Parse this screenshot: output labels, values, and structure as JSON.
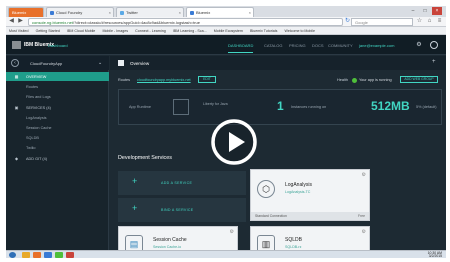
{
  "browser": {
    "tabs": [
      {
        "label": "Bluemix",
        "color": "#e8702a"
      },
      {
        "label": "Cloud Foundry",
        "color": "#3a7bd5"
      },
      {
        "label": "Twitter",
        "color": "#5aa9e6"
      },
      {
        "label": "Bluemix",
        "color": "#3a7bd5"
      }
    ],
    "url_host": "console.ng.bluemix.net",
    "url_path": "/?direct=classic/#/resources/appGuid=4ac8c9ad&bluemix.logstash=true",
    "search_placeholder": "Google",
    "bookmarks": [
      "Most Visited",
      "Getting Started",
      "IBM Cloud Mobile",
      "Mobile - Images",
      "Connect - Learning",
      "IBM Learning - Sca...",
      "Mobile Ecosystem",
      "Bluemix Tutorials",
      "Welcome to Mobile"
    ]
  },
  "app": {
    "brand": "IBM Bluemix",
    "brand_sub": "Dashboard",
    "nav": [
      "DASHBOARD",
      "CATALOG",
      "PRICING",
      "DOCS",
      "COMMUNITY"
    ],
    "active_nav": "DASHBOARD",
    "account": "jane@example.com"
  },
  "sidebar": {
    "app_name": "CloudFoundryApp",
    "items": [
      {
        "label": "OVERVIEW",
        "active": true
      },
      {
        "label": "Routes"
      },
      {
        "label": "Files and Logs"
      },
      {
        "label": "SERVICES (4)",
        "section": true
      },
      {
        "label": "LogAnalysis"
      },
      {
        "label": "Session Cache"
      },
      {
        "label": "SQLDB"
      },
      {
        "label": "Twilio"
      },
      {
        "label": "ADD GIT (4)",
        "section": true
      }
    ]
  },
  "main": {
    "title": "Overview",
    "routes_label": "Routes",
    "route_link": "cloudfoundryapp.mybluemix.net",
    "edit_label": "EDIT",
    "health_label": "Health",
    "health_text": "Your app is running",
    "add_group_label": "ADD WEB GROUP",
    "stats": {
      "app_runtime_label": "App Runtime",
      "runtime_text": "Liberty for Java",
      "instances": "1",
      "instances_label": "Instances running on",
      "memory": "512MB",
      "memory_label": "Memory Quota",
      "memory_pct": "5% (default)"
    },
    "dev_title": "Development Services",
    "add_service_label": "ADD A SERVICE",
    "bind_service_label": "BIND A SERVICE",
    "cards": [
      {
        "name": "LogAnalysis",
        "sub": "LogAnalysis-TC",
        "foot": "Standard Connection",
        "status": "Free",
        "icon": "⬡"
      },
      {
        "name": "Session Cache",
        "sub": "Session Cache-io",
        "foot": "",
        "status": "",
        "icon": "▤"
      },
      {
        "name": "SQLDB",
        "sub": "SQLDB-rz",
        "foot": "",
        "status": "",
        "icon": "▥"
      }
    ]
  },
  "taskbar": {
    "time": "10:30 AM",
    "date": "3/2/2015"
  },
  "colors": {
    "accent": "#41d6c3",
    "sidebar_active": "#1f9e8b",
    "health_ok": "#4fbf3a"
  }
}
